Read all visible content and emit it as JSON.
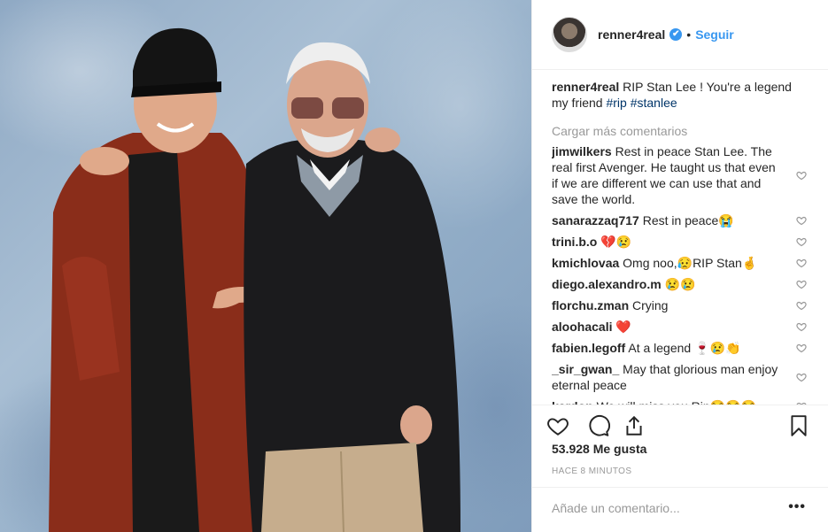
{
  "header": {
    "username": "renner4real",
    "verified_mark": "✔",
    "separator": "•",
    "follow_label": "Seguir"
  },
  "caption": {
    "username": "renner4real",
    "text": "RIP Stan Lee ! You're a legend my friend",
    "hashtags": [
      "#rip",
      "#stanlee"
    ]
  },
  "load_more_label": "Cargar más comentarios",
  "comments": [
    {
      "user": "jimwilkers",
      "text": "Rest in peace Stan Lee. The real first Avenger. He taught us that even if we are different we can use that and save the world."
    },
    {
      "user": "sanarazzaq717",
      "text": "Rest in peace😭"
    },
    {
      "user": "trini.b.o",
      "text": "💔😢"
    },
    {
      "user": "kmichlovaa",
      "text": "Omg noo,😥RIP Stan🤞"
    },
    {
      "user": "diego.alexandro.m",
      "text": "😢😢"
    },
    {
      "user": "florchu.zman",
      "text": "Crying"
    },
    {
      "user": "aloohacali",
      "text": "❤️"
    },
    {
      "user": "fabien.legoff",
      "text": "At a legend 🍷😢👏"
    },
    {
      "user": "_sir_gwan_",
      "text": "May that glorious man enjoy eternal peace"
    },
    {
      "user": "kardon",
      "text": "We will miss you Rip😭😭😭"
    }
  ],
  "icons": {
    "like": "heart-outline-icon",
    "comment": "speech-bubble-icon",
    "share": "share-upload-icon",
    "save": "bookmark-icon",
    "comment_like": "small-heart-icon",
    "more": "more-options-icon"
  },
  "likes_text": "53.928 Me gusta",
  "timestamp": "HACE 8 MINUTOS",
  "add_comment": {
    "placeholder": "Añade un comentario...",
    "more_label": "•••"
  },
  "colors": {
    "link_blue": "#3897f0",
    "hashtag": "#003569",
    "muted": "#999999",
    "text": "#262626",
    "divider": "#efefef"
  }
}
